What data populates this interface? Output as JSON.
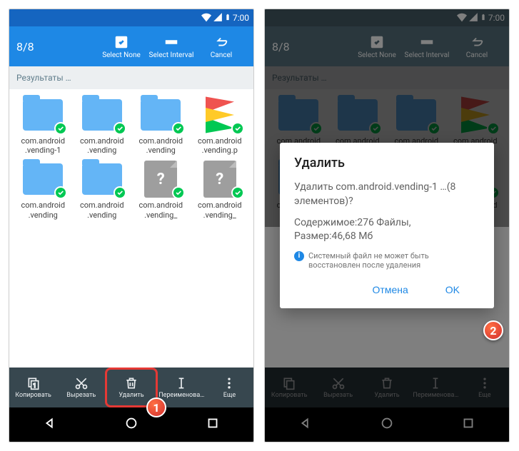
{
  "statusbar": {
    "time": "7:00"
  },
  "appbar": {
    "count": "8/8",
    "select_none": "Select None",
    "select_interval": "Select Interval",
    "cancel": "Cancel"
  },
  "breadcrumb": "Результаты …",
  "items": [
    {
      "type": "folder",
      "name": "com.android.vending-1"
    },
    {
      "type": "folder",
      "name": "com.android.vending"
    },
    {
      "type": "folder",
      "name": "com.android.vending"
    },
    {
      "type": "play",
      "name": "com.android.vending.p"
    },
    {
      "type": "folder",
      "name": "com.android.vending"
    },
    {
      "type": "folder",
      "name": "com.android.vending"
    },
    {
      "type": "file",
      "name": "com.android.vending_"
    },
    {
      "type": "file",
      "name": "com.android.vending_"
    }
  ],
  "bottombar": {
    "copy": "Копировать",
    "cut": "Вырезать",
    "delete": "Удалить",
    "rename": "Переименова…",
    "more": "Еще"
  },
  "dialog": {
    "title": "Удалить",
    "line1": "Удалить com.android.vending-1 …(8 элементов)?",
    "line2a": "Содержимое:276 Файлы,",
    "line2b": "Размер:46,68 Мб",
    "warning": "Системный файл не может быть восстановлен после удаления",
    "cancel": "Отмена",
    "ok": "OK"
  },
  "markers": {
    "one": "1",
    "two": "2"
  }
}
